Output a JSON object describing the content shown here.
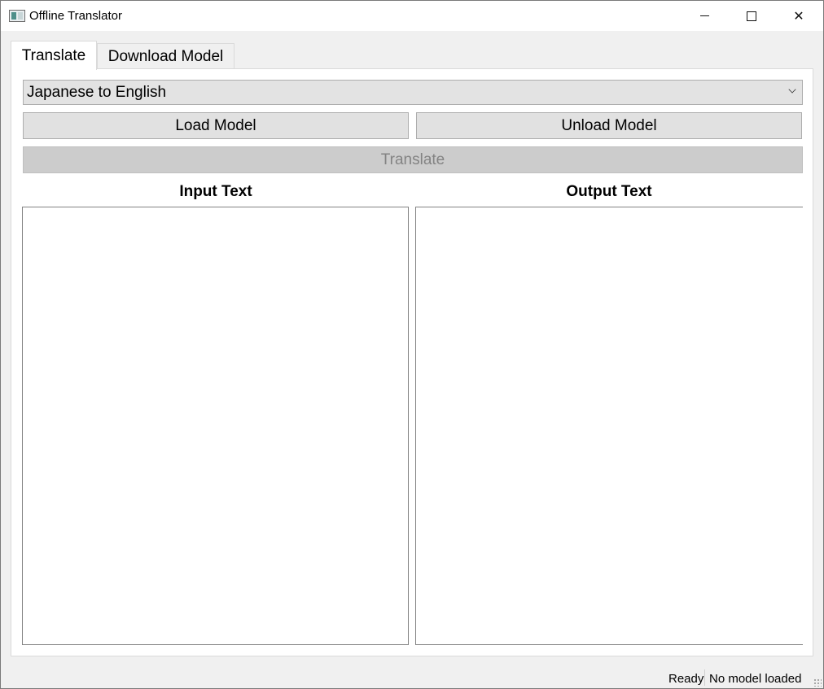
{
  "window": {
    "title": "Offline Translator",
    "minimize_label": "",
    "maximize_label": "",
    "close_label": "✕"
  },
  "tabs": [
    {
      "label": "Translate",
      "active": true
    },
    {
      "label": "Download Model",
      "active": false
    }
  ],
  "translate": {
    "language_pair": "Japanese to English",
    "load_model_label": "Load Model",
    "unload_model_label": "Unload Model",
    "translate_label": "Translate",
    "translate_enabled": false,
    "input_label": "Input Text",
    "output_label": "Output Text",
    "input_value": "",
    "output_value": ""
  },
  "status": {
    "state": "Ready",
    "model": "No model loaded"
  },
  "icons": {
    "app": "app-window-icon",
    "dropdown": "chevron-down-icon",
    "resize": "size-grip-icon"
  }
}
